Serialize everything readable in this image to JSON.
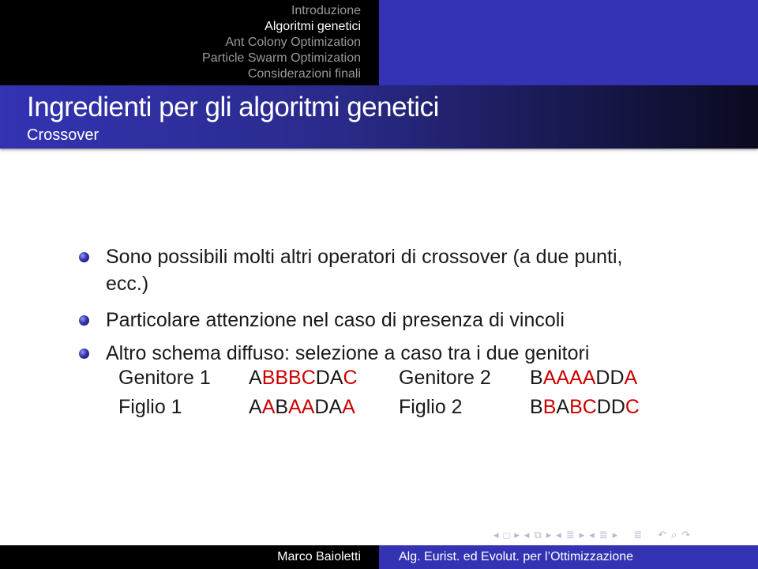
{
  "headline": {
    "sections": [
      {
        "label": "Introduzione",
        "active": false
      },
      {
        "label": "Algoritmi genetici",
        "active": true
      },
      {
        "label": "Ant Colony Optimization",
        "active": false
      },
      {
        "label": "Particle Swarm Optimization",
        "active": false
      },
      {
        "label": "Considerazioni finali",
        "active": false
      }
    ]
  },
  "frame": {
    "title": "Ingredienti per gli algoritmi genetici",
    "subtitle": "Crossover"
  },
  "bullets": [
    "Sono possibili molti altri operatori di crossover (a due punti, ecc.)",
    "Particolare attenzione nel caso di presenza di vincoli",
    "Altro schema diffuso: selezione a caso tra i due genitori"
  ],
  "example": {
    "rows": [
      {
        "label1": "Genitore 1",
        "seq1": [
          [
            "A",
            false
          ],
          [
            "BBBC",
            true
          ],
          [
            "DA",
            false
          ],
          [
            "C",
            true
          ]
        ],
        "label2": "Genitore 2",
        "seq2": [
          [
            "B",
            false
          ],
          [
            "AAAA",
            true
          ],
          [
            "DD",
            false
          ],
          [
            "A",
            true
          ]
        ]
      },
      {
        "label1": "Figlio 1",
        "seq1": [
          [
            "A",
            false
          ],
          [
            "A",
            true
          ],
          [
            "B",
            false
          ],
          [
            "AA",
            true
          ],
          [
            "DA",
            false
          ],
          [
            "A",
            true
          ]
        ],
        "label2": "Figlio 2",
        "seq2": [
          [
            "B",
            false
          ],
          [
            "B",
            true
          ],
          [
            "A",
            false
          ],
          [
            "BC",
            true
          ],
          [
            "DD",
            false
          ],
          [
            "C",
            true
          ]
        ]
      }
    ],
    "highlight_color": "#cc0000"
  },
  "nav": {
    "icons": [
      "prev-icon",
      "frame-icon",
      "next-icon",
      "prev-icon",
      "subsection-icon",
      "next-icon",
      "prev-icon",
      "section-icon",
      "next-icon",
      "prev-icon",
      "section-icon",
      "next-icon",
      "align-icon",
      "undo-icon",
      "search-icon",
      "redo-icon"
    ]
  },
  "footer": {
    "author": "Marco Baioletti",
    "course": "Alg. Eurist. ed Evolut. per l’Ottimizzazione"
  }
}
